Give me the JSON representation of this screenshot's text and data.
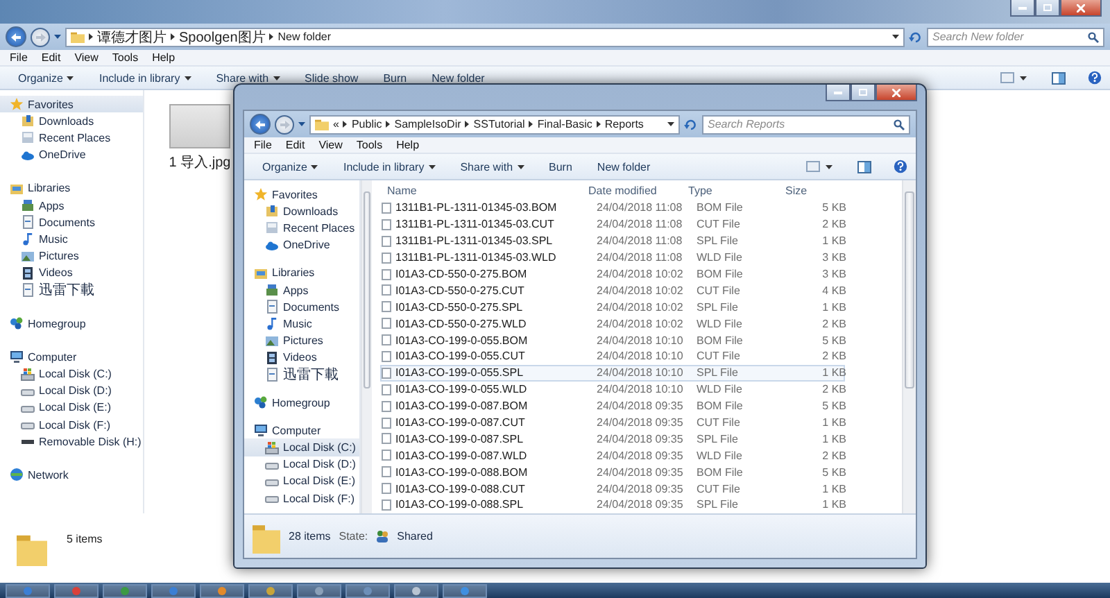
{
  "back_window": {
    "address": {
      "segments": [
        "谭德才图片",
        "Spoolgen图片",
        "New folder"
      ]
    },
    "search": {
      "placeholder": "Search New folder"
    },
    "menu": [
      "File",
      "Edit",
      "View",
      "Tools",
      "Help"
    ],
    "toolbar": [
      {
        "label": "Organize",
        "dropdown": true
      },
      {
        "label": "Include in library",
        "dropdown": true
      },
      {
        "label": "Share with",
        "dropdown": true
      },
      {
        "label": "Slide show",
        "dropdown": false
      },
      {
        "label": "Burn",
        "dropdown": false
      },
      {
        "label": "New folder",
        "dropdown": false
      }
    ],
    "nav": [
      {
        "label": "Favorites",
        "kind": "favorites",
        "selected": true,
        "children": [
          {
            "label": "Downloads",
            "kind": "downloads",
            "selected": false
          },
          {
            "label": "Recent Places",
            "kind": "recent",
            "selected": false
          },
          {
            "label": "OneDrive",
            "kind": "onedrive",
            "selected": false
          }
        ]
      },
      {
        "label": "Libraries",
        "kind": "libraries",
        "selected": false,
        "children": [
          {
            "label": "Apps",
            "kind": "apps",
            "selected": false
          },
          {
            "label": "Documents",
            "kind": "documents",
            "selected": false
          },
          {
            "label": "Music",
            "kind": "music",
            "selected": false
          },
          {
            "label": "Pictures",
            "kind": "pictures",
            "selected": false
          },
          {
            "label": "Videos",
            "kind": "videos",
            "selected": false
          },
          {
            "label": "迅雷下載",
            "kind": "thunder",
            "selected": false
          }
        ]
      },
      {
        "label": "Homegroup",
        "kind": "homegroup",
        "selected": false
      },
      {
        "label": "Computer",
        "kind": "computer",
        "selected": false,
        "children": [
          {
            "label": "Local Disk (C:)",
            "kind": "system",
            "selected": false
          },
          {
            "label": "Local Disk (D:)",
            "kind": "disk",
            "selected": false
          },
          {
            "label": "Local Disk (E:)",
            "kind": "disk",
            "selected": false
          },
          {
            "label": "Local Disk (F:)",
            "kind": "disk",
            "selected": false
          },
          {
            "label": "Removable Disk (H:)",
            "kind": "removable",
            "selected": false
          }
        ]
      },
      {
        "label": "Network",
        "kind": "network",
        "selected": false
      }
    ],
    "files": [
      {
        "name": "1 导入.jpg"
      }
    ],
    "status": "5 items"
  },
  "front_window": {
    "address": {
      "overflow": "«",
      "segments": [
        "Public",
        "SampleIsoDir",
        "SSTutorial",
        "Final-Basic",
        "Reports"
      ]
    },
    "search": {
      "placeholder": "Search Reports"
    },
    "menu": [
      "File",
      "Edit",
      "View",
      "Tools",
      "Help"
    ],
    "toolbar": [
      {
        "label": "Organize",
        "dropdown": true
      },
      {
        "label": "Include in library",
        "dropdown": true
      },
      {
        "label": "Share with",
        "dropdown": true
      },
      {
        "label": "Burn",
        "dropdown": false
      },
      {
        "label": "New folder",
        "dropdown": false
      }
    ],
    "nav": [
      {
        "label": "Favorites",
        "kind": "favorites",
        "selected": false,
        "children": [
          {
            "label": "Downloads",
            "kind": "downloads",
            "selected": false
          },
          {
            "label": "Recent Places",
            "kind": "recent",
            "selected": false
          },
          {
            "label": "OneDrive",
            "kind": "onedrive",
            "selected": false
          }
        ]
      },
      {
        "label": "Libraries",
        "kind": "libraries",
        "selected": false,
        "children": [
          {
            "label": "Apps",
            "kind": "apps",
            "selected": false
          },
          {
            "label": "Documents",
            "kind": "documents",
            "selected": false
          },
          {
            "label": "Music",
            "kind": "music",
            "selected": false
          },
          {
            "label": "Pictures",
            "kind": "pictures",
            "selected": false
          },
          {
            "label": "Videos",
            "kind": "videos",
            "selected": false
          },
          {
            "label": "迅雷下載",
            "kind": "thunder",
            "selected": false
          }
        ]
      },
      {
        "label": "Homegroup",
        "kind": "homegroup",
        "selected": false
      },
      {
        "label": "Computer",
        "kind": "computer",
        "selected": false,
        "children": [
          {
            "label": "Local Disk (C:)",
            "kind": "system",
            "selected": true
          },
          {
            "label": "Local Disk (D:)",
            "kind": "disk",
            "selected": false
          },
          {
            "label": "Local Disk (E:)",
            "kind": "disk",
            "selected": false
          },
          {
            "label": "Local Disk (F:)",
            "kind": "disk",
            "selected": false
          }
        ]
      }
    ],
    "columns": [
      "Name",
      "Date modified",
      "Type",
      "Size"
    ],
    "rows": [
      {
        "name": "1311B1-PL-1311-01345-03.BOM",
        "date": "24/04/2018 11:08",
        "type": "BOM File",
        "size": "5 KB",
        "selected": false
      },
      {
        "name": "1311B1-PL-1311-01345-03.CUT",
        "date": "24/04/2018 11:08",
        "type": "CUT File",
        "size": "2 KB",
        "selected": false
      },
      {
        "name": "1311B1-PL-1311-01345-03.SPL",
        "date": "24/04/2018 11:08",
        "type": "SPL File",
        "size": "1 KB",
        "selected": false
      },
      {
        "name": "1311B1-PL-1311-01345-03.WLD",
        "date": "24/04/2018 11:08",
        "type": "WLD File",
        "size": "3 KB",
        "selected": false
      },
      {
        "name": "I01A3-CD-550-0-275.BOM",
        "date": "24/04/2018 10:02",
        "type": "BOM File",
        "size": "3 KB",
        "selected": false
      },
      {
        "name": "I01A3-CD-550-0-275.CUT",
        "date": "24/04/2018 10:02",
        "type": "CUT File",
        "size": "4 KB",
        "selected": false
      },
      {
        "name": "I01A3-CD-550-0-275.SPL",
        "date": "24/04/2018 10:02",
        "type": "SPL File",
        "size": "1 KB",
        "selected": false
      },
      {
        "name": "I01A3-CD-550-0-275.WLD",
        "date": "24/04/2018 10:02",
        "type": "WLD File",
        "size": "2 KB",
        "selected": false
      },
      {
        "name": "I01A3-CO-199-0-055.BOM",
        "date": "24/04/2018 10:10",
        "type": "BOM File",
        "size": "5 KB",
        "selected": false
      },
      {
        "name": "I01A3-CO-199-0-055.CUT",
        "date": "24/04/2018 10:10",
        "type": "CUT File",
        "size": "2 KB",
        "selected": false
      },
      {
        "name": "I01A3-CO-199-0-055.SPL",
        "date": "24/04/2018 10:10",
        "type": "SPL File",
        "size": "1 KB",
        "selected": true
      },
      {
        "name": "I01A3-CO-199-0-055.WLD",
        "date": "24/04/2018 10:10",
        "type": "WLD File",
        "size": "2 KB",
        "selected": false
      },
      {
        "name": "I01A3-CO-199-0-087.BOM",
        "date": "24/04/2018 09:35",
        "type": "BOM File",
        "size": "5 KB",
        "selected": false
      },
      {
        "name": "I01A3-CO-199-0-087.CUT",
        "date": "24/04/2018 09:35",
        "type": "CUT File",
        "size": "1 KB",
        "selected": false
      },
      {
        "name": "I01A3-CO-199-0-087.SPL",
        "date": "24/04/2018 09:35",
        "type": "SPL File",
        "size": "1 KB",
        "selected": false
      },
      {
        "name": "I01A3-CO-199-0-087.WLD",
        "date": "24/04/2018 09:35",
        "type": "WLD File",
        "size": "2 KB",
        "selected": false
      },
      {
        "name": "I01A3-CO-199-0-088.BOM",
        "date": "24/04/2018 09:35",
        "type": "BOM File",
        "size": "5 KB",
        "selected": false
      },
      {
        "name": "I01A3-CO-199-0-088.CUT",
        "date": "24/04/2018 09:35",
        "type": "CUT File",
        "size": "1 KB",
        "selected": false
      },
      {
        "name": "I01A3-CO-199-0-088.SPL",
        "date": "24/04/2018 09:35",
        "type": "SPL File",
        "size": "1 KB",
        "selected": false
      }
    ],
    "status": {
      "count": "28 items",
      "state_label": "State:",
      "state": "Shared"
    }
  }
}
